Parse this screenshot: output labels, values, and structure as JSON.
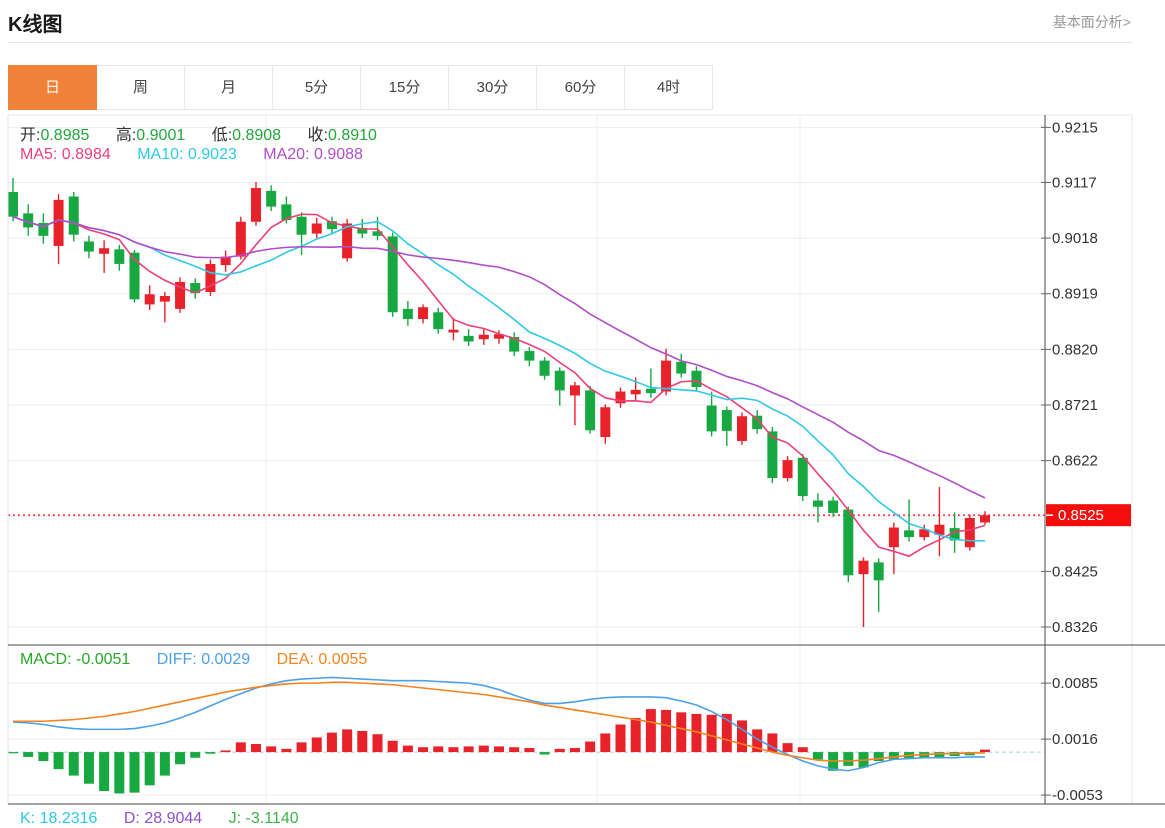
{
  "header": {
    "title": "K线图",
    "link": "基本面分析>"
  },
  "tabs": {
    "items": [
      "日",
      "周",
      "月",
      "5分",
      "15分",
      "30分",
      "60分",
      "4时"
    ],
    "active_index": 0
  },
  "legend": {
    "ohlc": {
      "open_label": "开:",
      "open": "0.8985",
      "high_label": "高:",
      "high": "0.9001",
      "low_label": "低:",
      "low": "0.8908",
      "close_label": "收:",
      "close": "0.8910"
    },
    "ma": {
      "ma5_label": "MA5:",
      "ma5": "0.8984",
      "ma10_label": "MA10:",
      "ma10": "0.9023",
      "ma20_label": "MA20:",
      "ma20": "0.9088"
    },
    "macd": {
      "macd_label": "MACD:",
      "macd": "-0.0051",
      "diff_label": "DIFF:",
      "diff": "0.0029",
      "dea_label": "DEA:",
      "dea": "0.0055"
    },
    "kdj": {
      "k_label": "K:",
      "k": "18.2316",
      "d_label": "D:",
      "d": "28.9044",
      "j_label": "J:",
      "j": "-3.1140"
    }
  },
  "colors": {
    "accent": "#ef8139",
    "candle_up": "#e8222a",
    "candle_down": "#18a842",
    "ma5": "#ee3f77",
    "ma10": "#2fc9e8",
    "ma20": "#b04ec8",
    "diff": "#4da0e8",
    "dea": "#f5831f",
    "macd_pos": "#e8222a",
    "macd_neg": "#18a842",
    "price_line": "#ff2b2b",
    "price_badge": "#f30d0d",
    "grid": "#e9edf3",
    "axis_text": "#333333",
    "zero_line": "#9ed2f2"
  },
  "chart_data": {
    "type": "candlestick",
    "title": "K线图 daily candles with MA5/MA10/MA20 overlays and MACD panel",
    "main": {
      "ylim": [
        0.8294,
        0.9237
      ],
      "yticks": [
        0.9215,
        0.9117,
        0.9018,
        0.8919,
        0.882,
        0.8721,
        0.8622,
        0.8425,
        0.8326
      ],
      "hidden_tick": 0.8523,
      "last_price": 0.8525,
      "last_price_label": "0.8525",
      "ma_periods": [
        5,
        10,
        20
      ],
      "candles": [
        [
          0.91,
          0.9125,
          0.9048,
          0.9056
        ],
        [
          0.9062,
          0.9078,
          0.9022,
          0.9037
        ],
        [
          0.9045,
          0.9062,
          0.9008,
          0.9022
        ],
        [
          0.9004,
          0.9096,
          0.8972,
          0.9086
        ],
        [
          0.9092,
          0.91,
          0.9012,
          0.9024
        ],
        [
          0.9012,
          0.9022,
          0.8982,
          0.8994
        ],
        [
          0.899,
          0.9014,
          0.8956,
          0.9
        ],
        [
          0.8998,
          0.9006,
          0.896,
          0.8972
        ],
        [
          0.8992,
          0.8997,
          0.8903,
          0.8909
        ],
        [
          0.89,
          0.8934,
          0.889,
          0.8918
        ],
        [
          0.8905,
          0.8922,
          0.8868,
          0.8915
        ],
        [
          0.8892,
          0.8948,
          0.8885,
          0.894
        ],
        [
          0.8938,
          0.8946,
          0.891,
          0.892
        ],
        [
          0.8922,
          0.898,
          0.8915,
          0.8972
        ],
        [
          0.897,
          0.8996,
          0.8958,
          0.8985
        ],
        [
          0.8985,
          0.9056,
          0.898,
          0.9047
        ],
        [
          0.9047,
          0.9118,
          0.904,
          0.9107
        ],
        [
          0.9102,
          0.9112,
          0.9066,
          0.9074
        ],
        [
          0.9078,
          0.9092,
          0.9044,
          0.905
        ],
        [
          0.9056,
          0.9064,
          0.8988,
          0.9024
        ],
        [
          0.9026,
          0.9054,
          0.9018,
          0.9044
        ],
        [
          0.9048,
          0.9056,
          0.9026,
          0.9034
        ],
        [
          0.8982,
          0.9052,
          0.8976,
          0.9044
        ],
        [
          0.9036,
          0.9052,
          0.9018,
          0.9026
        ],
        [
          0.903,
          0.9056,
          0.9014,
          0.9022
        ],
        [
          0.9021,
          0.9028,
          0.8878,
          0.8886
        ],
        [
          0.8892,
          0.8906,
          0.8862,
          0.8874
        ],
        [
          0.8874,
          0.89,
          0.8866,
          0.8895
        ],
        [
          0.8886,
          0.8894,
          0.8848,
          0.8856
        ],
        [
          0.885,
          0.8876,
          0.8836,
          0.8855
        ],
        [
          0.8844,
          0.8856,
          0.8826,
          0.8834
        ],
        [
          0.8838,
          0.8856,
          0.8828,
          0.8846
        ],
        [
          0.8839,
          0.8854,
          0.883,
          0.8847
        ],
        [
          0.8842,
          0.885,
          0.8808,
          0.8816
        ],
        [
          0.8817,
          0.8824,
          0.879,
          0.88
        ],
        [
          0.88,
          0.8806,
          0.8766,
          0.8773
        ],
        [
          0.8782,
          0.8788,
          0.872,
          0.8747
        ],
        [
          0.8738,
          0.8762,
          0.8685,
          0.8756
        ],
        [
          0.8747,
          0.8755,
          0.867,
          0.8676
        ],
        [
          0.8664,
          0.8722,
          0.8652,
          0.8717
        ],
        [
          0.8724,
          0.8752,
          0.8716,
          0.8745
        ],
        [
          0.874,
          0.877,
          0.873,
          0.8748
        ],
        [
          0.875,
          0.8786,
          0.8734,
          0.8742
        ],
        [
          0.8745,
          0.8821,
          0.8738,
          0.88
        ],
        [
          0.8798,
          0.8812,
          0.877,
          0.8777
        ],
        [
          0.8782,
          0.879,
          0.8746,
          0.8753
        ],
        [
          0.872,
          0.8745,
          0.8665,
          0.8674
        ],
        [
          0.8712,
          0.8718,
          0.8648,
          0.8675
        ],
        [
          0.8657,
          0.8708,
          0.865,
          0.8701
        ],
        [
          0.8702,
          0.8712,
          0.867,
          0.8678
        ],
        [
          0.8674,
          0.8682,
          0.8582,
          0.8591
        ],
        [
          0.8591,
          0.863,
          0.8585,
          0.8623
        ],
        [
          0.8627,
          0.8634,
          0.855,
          0.8559
        ],
        [
          0.8551,
          0.8564,
          0.8512,
          0.854
        ],
        [
          0.8551,
          0.8558,
          0.8522,
          0.8529
        ],
        [
          0.8535,
          0.854,
          0.8406,
          0.8418
        ],
        [
          0.842,
          0.845,
          0.8326,
          0.8444
        ],
        [
          0.8441,
          0.8448,
          0.8353,
          0.8409
        ],
        [
          0.8468,
          0.8512,
          0.842,
          0.8503
        ],
        [
          0.8498,
          0.8553,
          0.8478,
          0.8486
        ],
        [
          0.8486,
          0.8508,
          0.848,
          0.85
        ],
        [
          0.849,
          0.8575,
          0.8452,
          0.8508
        ],
        [
          0.8502,
          0.853,
          0.8458,
          0.848
        ],
        [
          0.8468,
          0.8526,
          0.8462,
          0.852
        ],
        [
          0.8512,
          0.8532,
          0.8508,
          0.8525
        ]
      ]
    },
    "macd": {
      "ylim": [
        -0.0064,
        0.0132
      ],
      "yticks": [
        0.0085,
        0.0016,
        -0.0053
      ],
      "hist": [
        -0.0001,
        -0.0006,
        -0.0011,
        -0.0021,
        -0.0029,
        -0.0039,
        -0.0048,
        -0.0051,
        -0.005,
        -0.0041,
        -0.0029,
        -0.0015,
        -0.0007,
        -0.0002,
        0.0002,
        0.0012,
        0.001,
        0.0007,
        0.0004,
        0.0012,
        0.0018,
        0.0024,
        0.0028,
        0.0026,
        0.0022,
        0.0014,
        0.0008,
        0.0006,
        0.0007,
        0.0006,
        0.0007,
        0.0008,
        0.0007,
        0.0006,
        0.0005,
        -0.0003,
        0.0004,
        0.0005,
        0.0013,
        0.0023,
        0.0034,
        0.0042,
        0.0053,
        0.0052,
        0.0049,
        0.0047,
        0.0046,
        0.0047,
        0.0039,
        0.0028,
        0.0023,
        0.0011,
        0.0006,
        -0.0009,
        -0.0023,
        -0.0017,
        -0.0019,
        -0.0011,
        -0.0009,
        -0.0008,
        -0.0007,
        -0.0006,
        -0.0005,
        -0.0004,
        0.0003
      ],
      "diff": [
        0.0037,
        0.0036,
        0.0034,
        0.0031,
        0.0029,
        0.0028,
        0.0028,
        0.0028,
        0.0029,
        0.0032,
        0.0036,
        0.0042,
        0.0049,
        0.0057,
        0.0065,
        0.0072,
        0.0079,
        0.0084,
        0.0088,
        0.009,
        0.0091,
        0.0092,
        0.0091,
        0.009,
        0.0089,
        0.0088,
        0.0088,
        0.0088,
        0.0087,
        0.0086,
        0.0085,
        0.0082,
        0.0077,
        0.007,
        0.0064,
        0.006,
        0.006,
        0.0062,
        0.0065,
        0.0067,
        0.0068,
        0.0068,
        0.0068,
        0.0067,
        0.0063,
        0.0058,
        0.005,
        0.004,
        0.0028,
        0.0016,
        0.0006,
        -0.0003,
        -0.0011,
        -0.0017,
        -0.0021,
        -0.0023,
        -0.0019,
        -0.0013,
        -0.0009,
        -0.0008,
        -0.0007,
        -0.0007,
        -0.0007,
        -0.0006,
        -0.0006
      ],
      "dea": [
        0.0038,
        0.0038,
        0.0038,
        0.0039,
        0.004,
        0.0042,
        0.0044,
        0.0047,
        0.005,
        0.0054,
        0.0058,
        0.0062,
        0.0066,
        0.007,
        0.0074,
        0.0077,
        0.008,
        0.0082,
        0.0084,
        0.0085,
        0.0085,
        0.0086,
        0.0086,
        0.0085,
        0.0084,
        0.0083,
        0.0081,
        0.0079,
        0.0077,
        0.0075,
        0.0073,
        0.0071,
        0.0068,
        0.0065,
        0.0062,
        0.0058,
        0.0055,
        0.0052,
        0.0049,
        0.0046,
        0.0043,
        0.004,
        0.0037,
        0.0033,
        0.0029,
        0.0025,
        0.002,
        0.0015,
        0.001,
        0.0005,
        0.0,
        -0.0004,
        -0.0007,
        -0.001,
        -0.0011,
        -0.0011,
        -0.001,
        -0.0008,
        -0.0006,
        -0.0004,
        -0.0003,
        -0.0002,
        -0.0002,
        -0.0001,
        -0.0001
      ]
    }
  }
}
